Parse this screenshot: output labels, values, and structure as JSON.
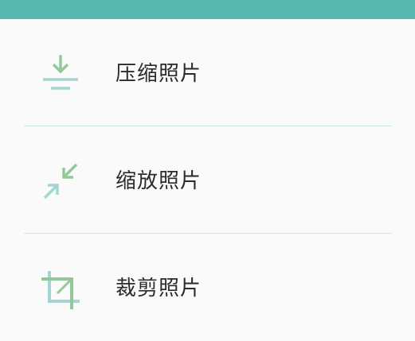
{
  "colors": {
    "topbar": "#59b8b0",
    "icon_green": "#93c99a",
    "icon_teal": "#a5d5d1",
    "divider": "#cfe6e2"
  },
  "menu": {
    "items": [
      {
        "label": "压缩照片",
        "icon": "compress-download-icon"
      },
      {
        "label": "缩放照片",
        "icon": "resize-arrows-icon"
      },
      {
        "label": "裁剪照片",
        "icon": "crop-icon"
      }
    ]
  }
}
